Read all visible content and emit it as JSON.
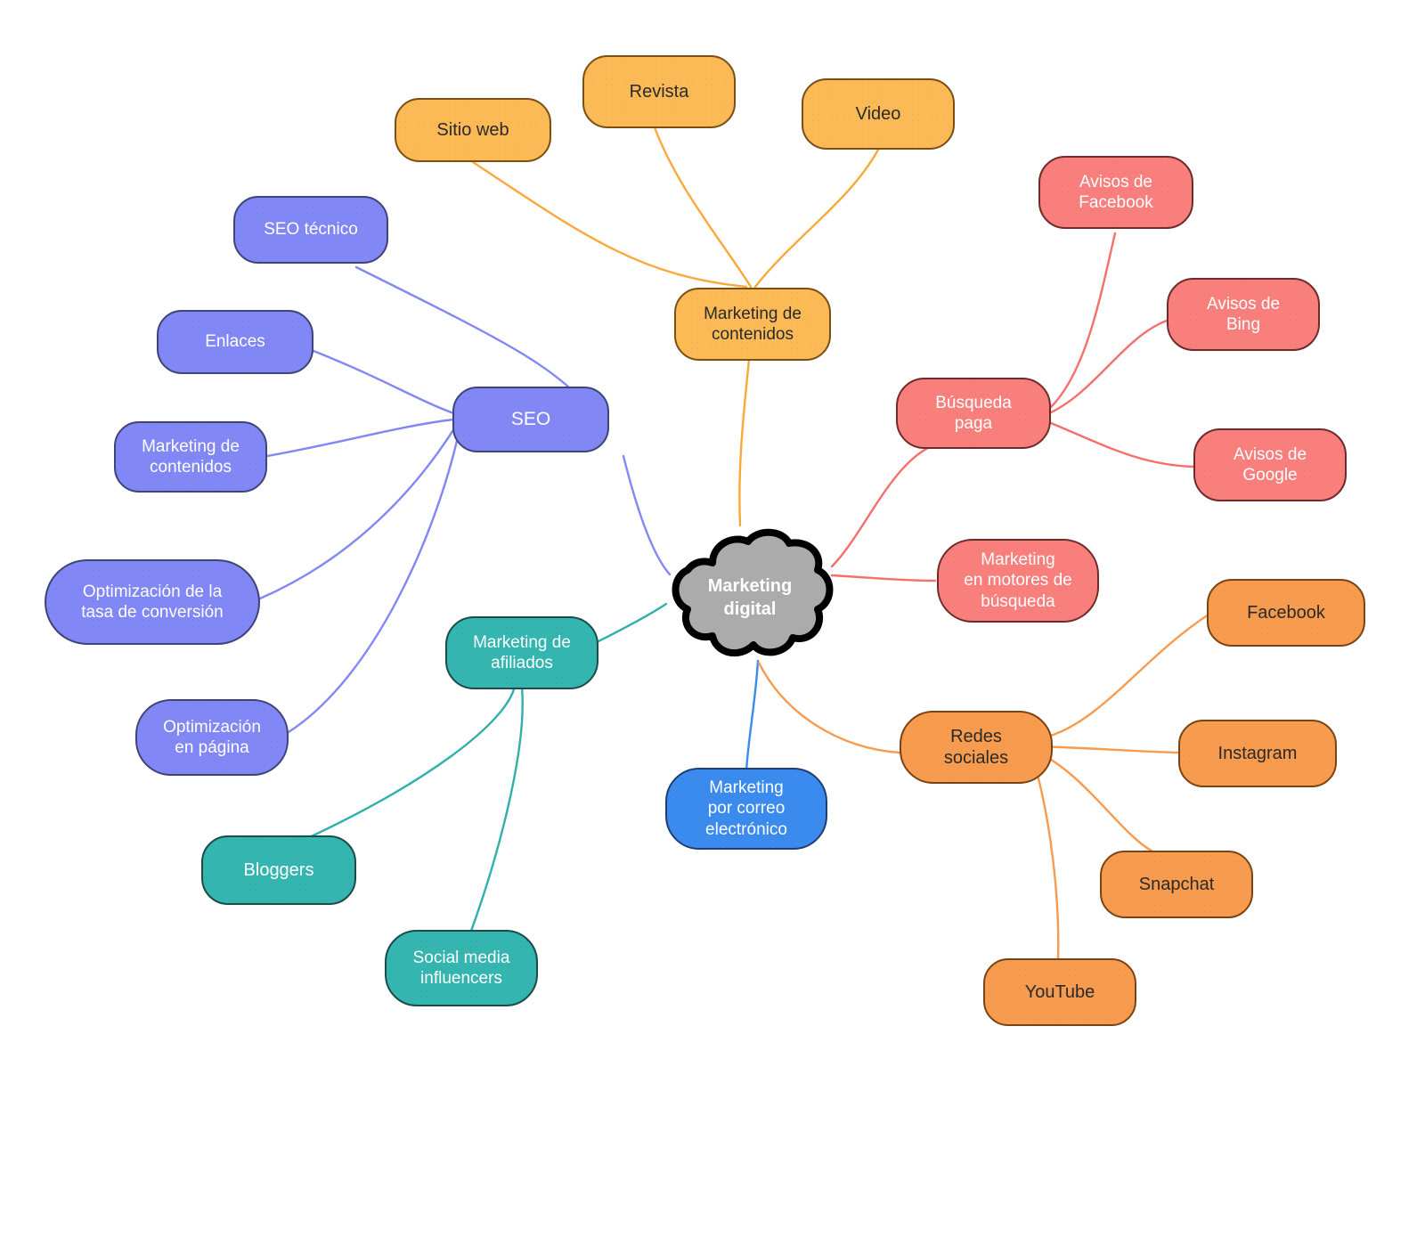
{
  "diagram": {
    "title": "Marketing digital",
    "type": "mind-map",
    "background": "#ffffff",
    "root": {
      "label": "Marketing digital",
      "shape": "cloud",
      "fill": "#ababab",
      "stroke": "#000000",
      "text_color": "#ffffff"
    },
    "palette": {
      "content_marketing": "#FBBA55",
      "seo": "#8187F5",
      "affiliate": "#34B5B0",
      "paid_search": "#F87F7C",
      "social": "#F79B4F",
      "email": "#3B8BEF"
    },
    "branches": [
      {
        "key": "content_marketing",
        "label": "Marketing de\ncontenidos",
        "color": "#FBBA55",
        "children": [
          "Sitio web",
          "Revista",
          "Video"
        ]
      },
      {
        "key": "seo",
        "label": "SEO",
        "color": "#8187F5",
        "children": [
          "SEO técnico",
          "Enlaces",
          "Marketing de\ncontenidos",
          "Optimización de la\ntasa de conversión",
          "Optimización\nen página"
        ]
      },
      {
        "key": "affiliate",
        "label": "Marketing de\nafiliados",
        "color": "#34B5B0",
        "children": [
          "Bloggers",
          "Social media\ninfluencers"
        ]
      },
      {
        "key": "paid_search",
        "label": "Búsqueda\npaga",
        "color": "#F87F7C",
        "children": [
          "Avisos de\nFacebook",
          "Avisos de\nBing",
          "Avisos de\nGoogle"
        ]
      },
      {
        "key": "search_engine_marketing",
        "label": "Marketing\nen motores de\nbúsqueda",
        "color": "#F87F7C",
        "children": []
      },
      {
        "key": "social",
        "label": "Redes\nsociales",
        "color": "#F79B4F",
        "children": [
          "Facebook",
          "Instagram",
          "Snapchat",
          "YouTube"
        ]
      },
      {
        "key": "email",
        "label": "Marketing\npor correo\nelectrónico",
        "color": "#3B8BEF",
        "children": []
      }
    ]
  },
  "nodes": {
    "sitio_web": "Sitio web",
    "revista": "Revista",
    "video": "Video",
    "marketing_contenidos": "Marketing de\ncontenidos",
    "seo_tecnico": "SEO técnico",
    "enlaces": "Enlaces",
    "seo_marketing_contenidos": "Marketing de\ncontenidos",
    "optimizacion_conversion": "Optimización de la\ntasa de conversión",
    "optimizacion_pagina": "Optimización\nen página",
    "seo": "SEO",
    "marketing_afiliados": "Marketing de\nafiliados",
    "bloggers": "Bloggers",
    "social_media_influencers": "Social media\ninfluencers",
    "marketing_correo": "Marketing\npor correo\nelectrónico",
    "busqueda_paga": "Búsqueda\npaga",
    "avisos_facebook": "Avisos de\nFacebook",
    "avisos_bing": "Avisos de\nBing",
    "avisos_google": "Avisos de\nGoogle",
    "marketing_motores": "Marketing\nen motores de\nbúsqueda",
    "redes_sociales": "Redes\nsociales",
    "facebook": "Facebook",
    "instagram": "Instagram",
    "snapchat": "Snapchat",
    "youtube": "YouTube",
    "root": "Marketing\ndigital"
  }
}
